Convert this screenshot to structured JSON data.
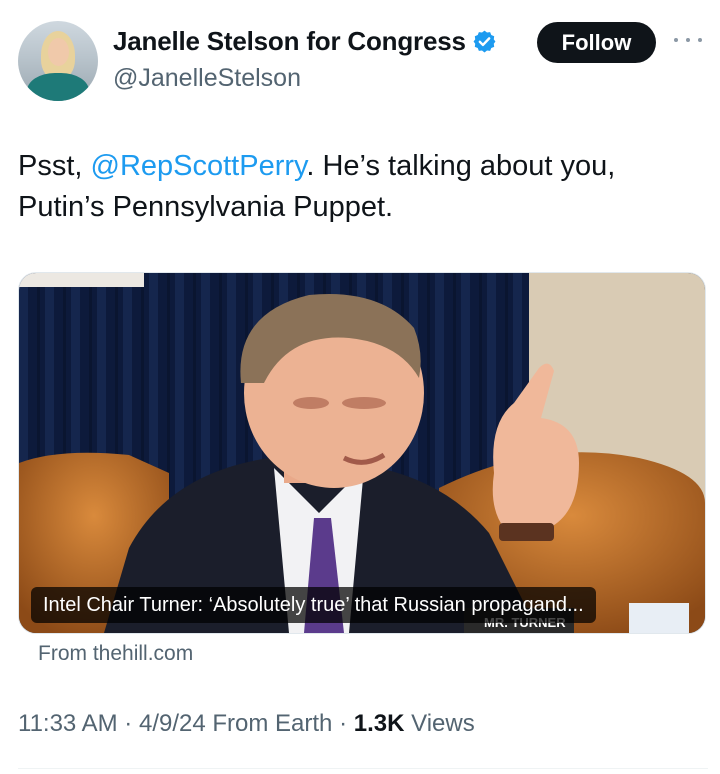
{
  "author": {
    "name": "Janelle Stelson for Congress",
    "handle": "@JanelleStelson"
  },
  "follow_label": "Follow",
  "tweet": {
    "prefix": "Psst, ",
    "mention": "@RepScottPerry",
    "line1_rest": ". He’s talking about you,",
    "line2": "Putin’s Pennsylvania Puppet."
  },
  "card": {
    "caption": "Intel Chair Turner: ‘Absolutely true’ that Russian propagand...",
    "nameplate": "MR. TURNER",
    "source": "From thehill.com"
  },
  "meta": {
    "time": "11:33 AM",
    "date": "4/9/24",
    "from": "From Earth",
    "views_count": "1.3K",
    "views_label": "Views"
  },
  "colors": {
    "link": "#1d9bf0",
    "verified": "#1d9bf0",
    "follow_bg": "#0f1419",
    "secondary_text": "#536471"
  }
}
